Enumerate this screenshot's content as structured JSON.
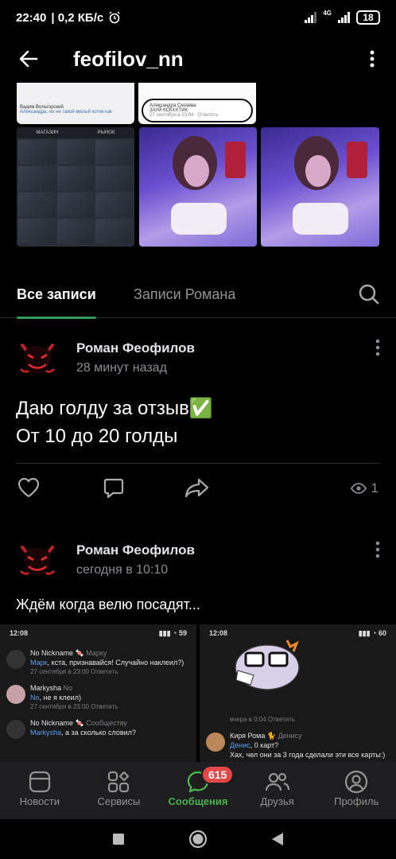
{
  "statusbar": {
    "time": "22:40",
    "speed": "0,2 КБ/с",
    "network": "4G",
    "battery": "18"
  },
  "header": {
    "title": "feofilov_nn"
  },
  "thumbs": {
    "a": {
      "line1": "Вадим Вольгорский",
      "line2": "Александра, но не такой милый котик как"
    },
    "b": {
      "line1": "Александра Скоаева",
      "line2": "ЗАУЙ КСКХХТИК",
      "line3": "27 сентября в 23:04 · Ответить"
    },
    "shop_tabs": [
      "МАГАЗИН",
      "РЫНОК"
    ]
  },
  "tabs": {
    "all": "Все записи",
    "owner": "Записи Романа"
  },
  "post1": {
    "author": "Роман Феофилов",
    "date": "28 минут назад",
    "line1": "Даю голду за отзыв✅",
    "line2": "От 10 до 20 голды",
    "views": "1"
  },
  "post2": {
    "author": "Роман Феофилов",
    "date": "сегодня в 10:10",
    "text": "Ждём когда велю посадят..."
  },
  "shot_left": {
    "time": "12:08",
    "comments": [
      {
        "name": "No Nickname 🍬",
        "reply_to": "Марку",
        "link": "Марк",
        "text": ", кста, признавайся! Случайно наклеил?)",
        "meta": "27 сентября в 23:00   Ответить"
      },
      {
        "name": "Markysha",
        "reply_to": "No",
        "link": "No",
        "text": ", не я клеил)",
        "meta": "27 сентября в 23:00   Ответить"
      },
      {
        "name": "No Nickname 🍬",
        "reply_to": "Сообществу",
        "link": "Markysha",
        "text": ", а за сколько словил?",
        "meta": ""
      }
    ]
  },
  "shot_right": {
    "time": "12:08",
    "meta": "вчера в 0:04   Ответить",
    "name": "Киря Рома 🐈",
    "reply_to": "Денису",
    "link": "Денис",
    "text": ", 0 карт?",
    "text2": "Хах, чел они за 3 года сделали эти все карты:)"
  },
  "nav": {
    "news": "Новости",
    "services": "Сервисы",
    "messages": "Сообщения",
    "messages_badge": "615",
    "friends": "Друзья",
    "profile": "Профиль"
  },
  "colors": {
    "accent": "#4bb34b",
    "tab_underline": "#2f9a5a",
    "badge": "#e64646"
  }
}
